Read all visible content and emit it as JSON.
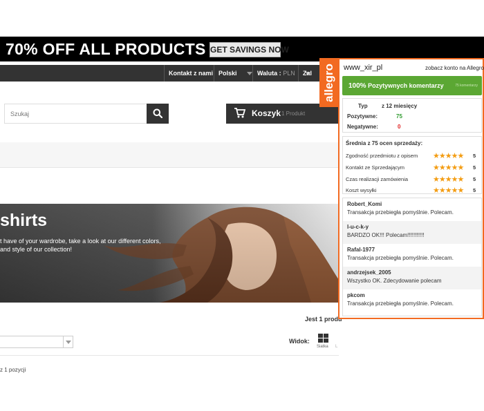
{
  "promo": {
    "text": "70% OFF ALL PRODUCTS",
    "button": "GET SAVINGS NOW"
  },
  "nav": {
    "contact": "Kontakt z nami",
    "language": "Polski",
    "currency_label": "Waluta :",
    "currency_value": "PLN",
    "login_partial": "Zal"
  },
  "search": {
    "placeholder": "Szukaj"
  },
  "cart": {
    "label": "Koszyk",
    "count": "1 Produkt"
  },
  "banner": {
    "title": "shirts",
    "line1": "t have of your wardrobe, take a look at our different colors,",
    "line2": "and style of our collection!"
  },
  "listing": {
    "results": "Jest 1 produ",
    "view_label": "Widok:",
    "grid_caption": "Siatka",
    "list_caption": "L",
    "position_text": "z 1 pozycji"
  },
  "allegro": {
    "tab_label": "allegro",
    "username": "www_xir_pl",
    "account_link": "zobacz konto na Allegro",
    "positive_percent": "100%",
    "positive_label": "Pozytywnych komentarzy",
    "comment_count": "75 komentarzy",
    "table": {
      "type_header": "Typ",
      "period_header": "z 12 miesięcy",
      "positive_label": "Pozytywne:",
      "positive_value": "75",
      "negative_label": "Negatywne:",
      "negative_value": "0"
    },
    "ratings_heading": "Średnia z 75 ocen sprzedaży:",
    "ratings": [
      {
        "label": "Zgodność przedmiotu z opisem",
        "stars": 5,
        "value": "5"
      },
      {
        "label": "Kontakt ze Sprzedającym",
        "stars": 5,
        "value": "5"
      },
      {
        "label": "Czas realizacji zamówienia",
        "stars": 5,
        "value": "5"
      },
      {
        "label": "Koszt wysyłki",
        "stars": 5,
        "value": "5"
      }
    ],
    "comments": [
      {
        "user": "Robert_Komi",
        "text": "Transakcja przebiegła pomyślnie. Polecam."
      },
      {
        "user": "l-u-c-k-y",
        "text": "BARDZO OK!!! Polecam!!!!!!!!!!!"
      },
      {
        "user": "Rafal-1977",
        "text": "Transakcja przebiegła pomyślnie. Polecam."
      },
      {
        "user": "andrzejsek_2005",
        "text": "Wszystko OK. Zdecydowanie polecam"
      },
      {
        "user": "pkcom",
        "text": "Transakcja przebiegła pomyślnie. Polecam."
      }
    ],
    "colors": {
      "brand": "#f26a21",
      "positive": "#5ba733"
    }
  }
}
